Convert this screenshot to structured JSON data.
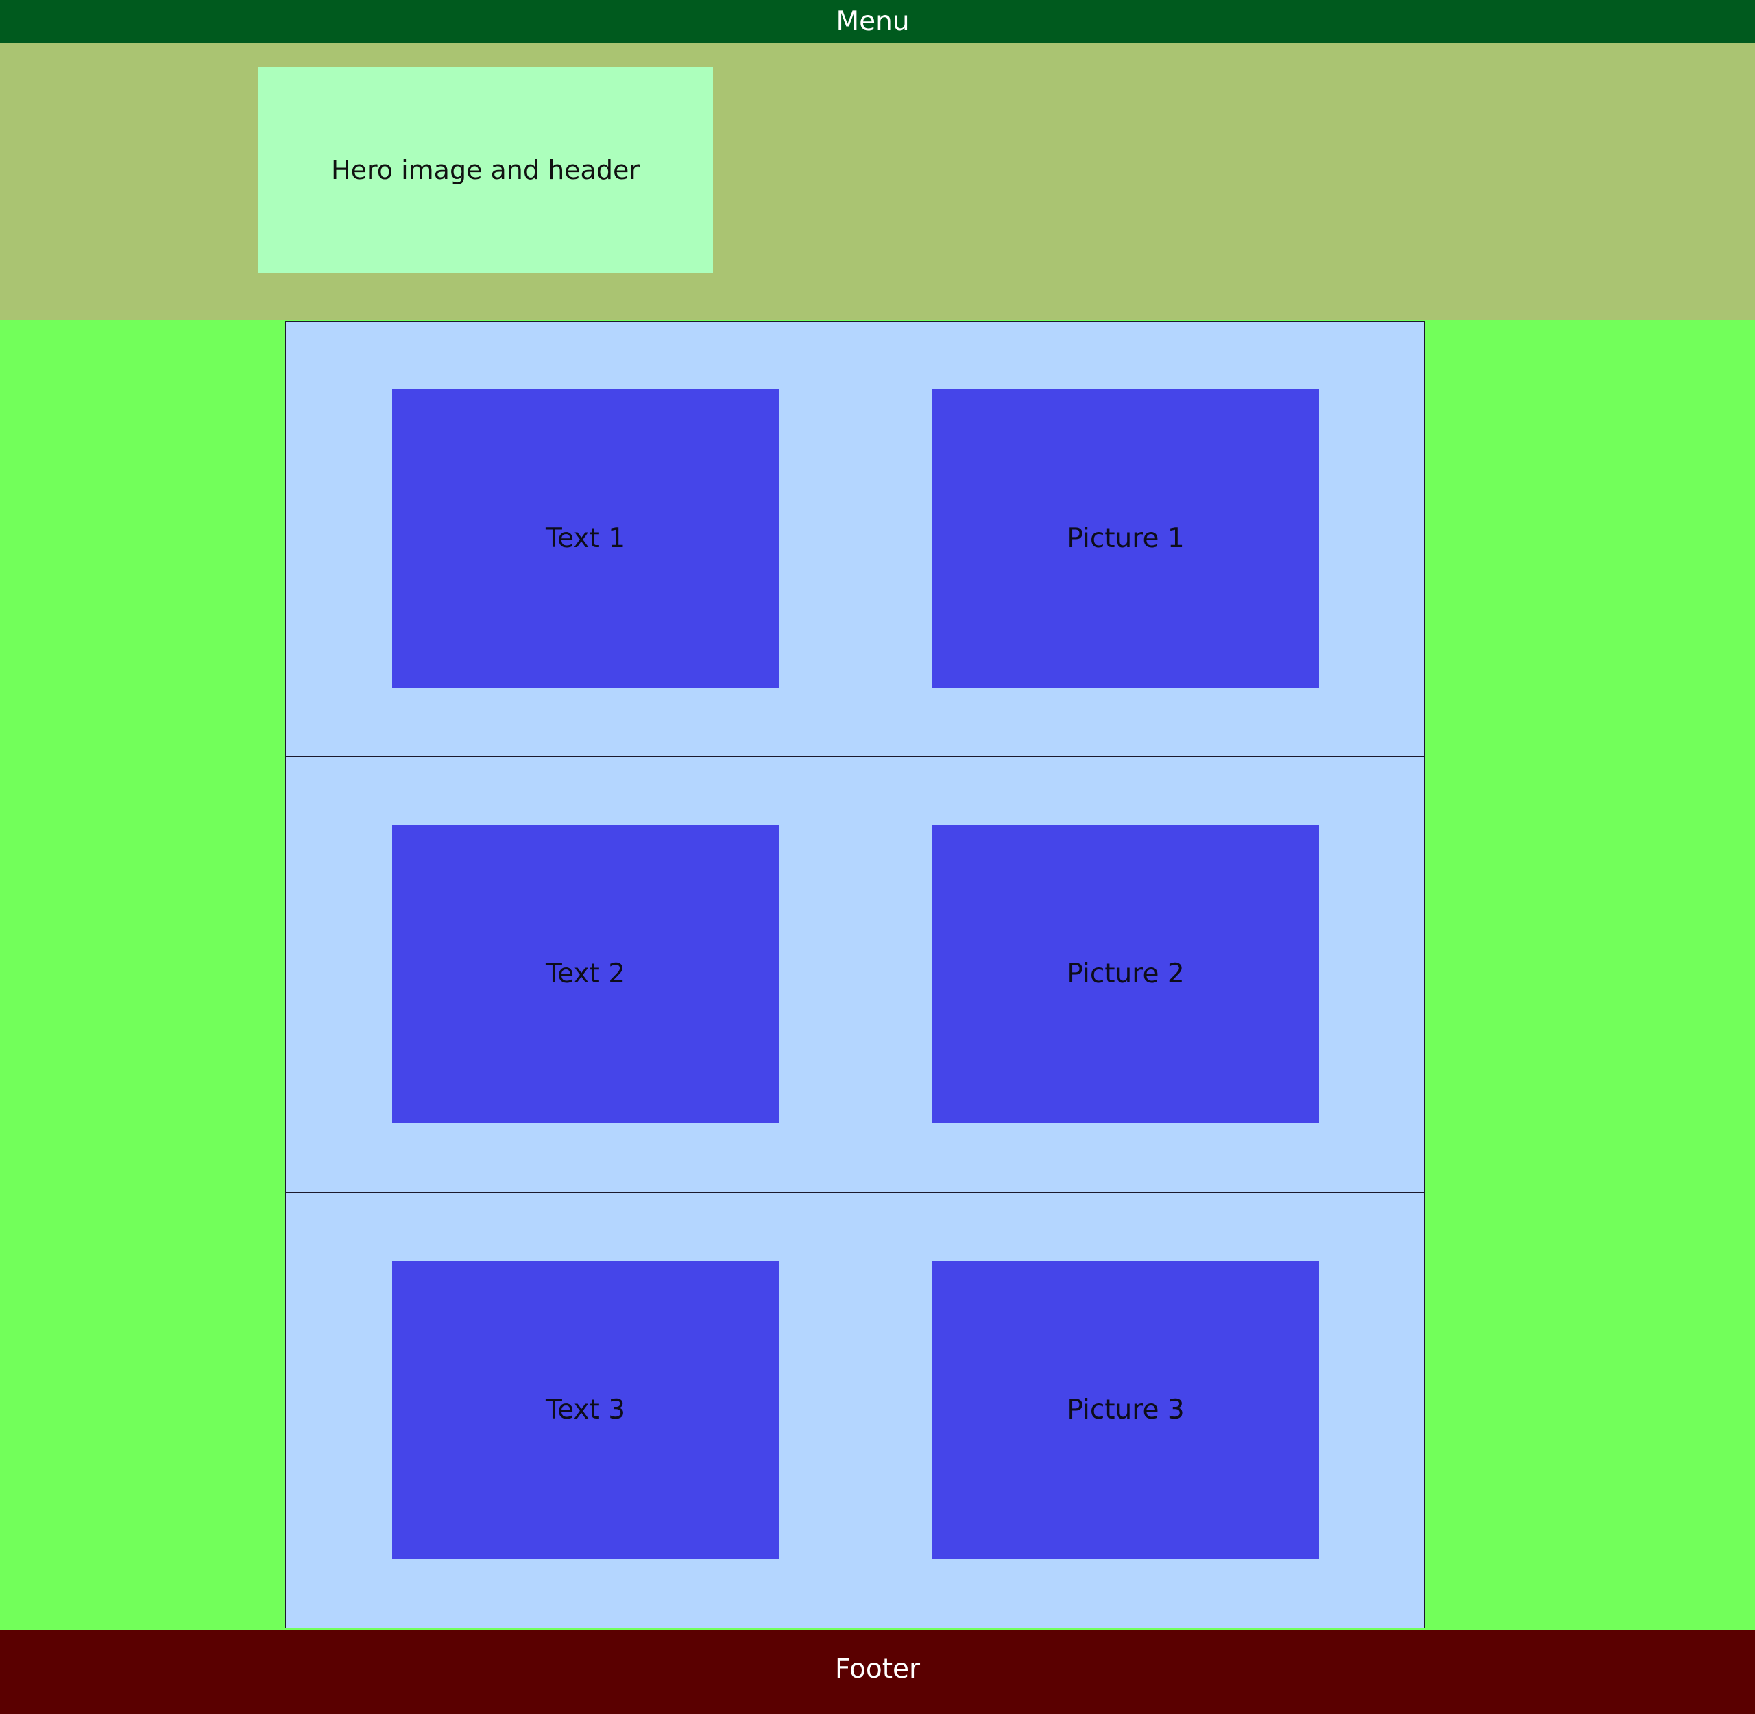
{
  "menu": {
    "label": "Menu"
  },
  "hero": {
    "label": "Hero image and header"
  },
  "sections": [
    {
      "text": "Text 1",
      "picture": "Picture 1"
    },
    {
      "text": "Text 2",
      "picture": "Picture 2"
    },
    {
      "text": "Text 3",
      "picture": "Picture 3"
    }
  ],
  "footer": {
    "label": "Footer"
  },
  "colors": {
    "menu_bg": "#005a1e",
    "hero_band_bg": "#aac472",
    "hero_box_bg": "#acffbc",
    "page_bg": "#72ff5a",
    "section_bg": "#b4d6ff",
    "block_bg": "#4545e9",
    "footer_bg": "#5a0000"
  }
}
